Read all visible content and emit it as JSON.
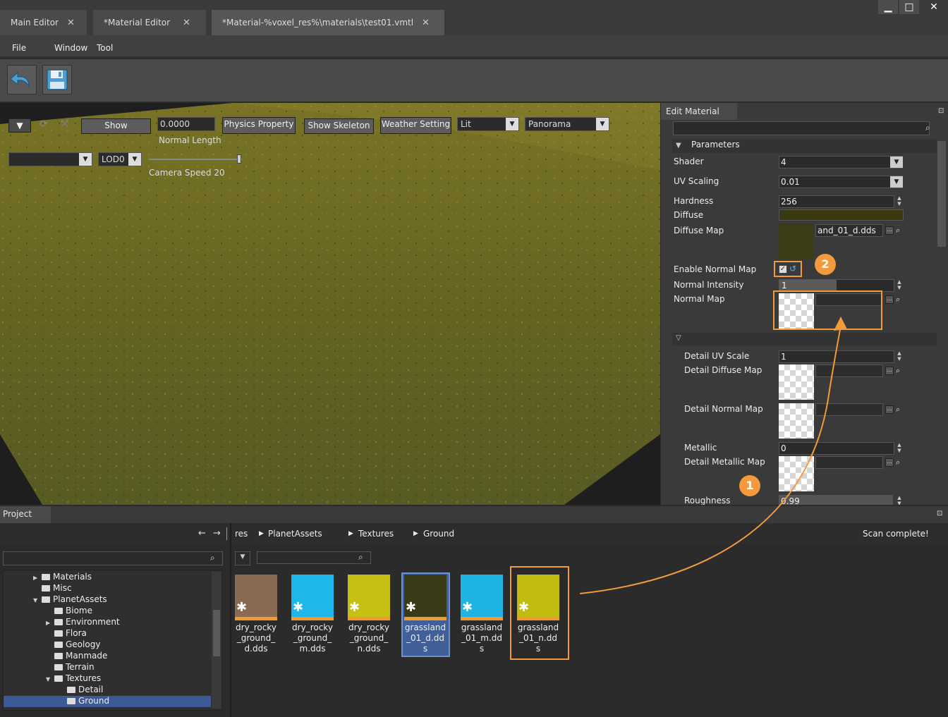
{
  "tabs": [
    {
      "label": "Main Editor"
    },
    {
      "label": "*Material Editor"
    },
    {
      "label": "*Material-%voxel_res%\\materials\\test01.vmtl"
    }
  ],
  "window_controls": {
    "minimize": "▁",
    "maximize": "□",
    "close": "✕"
  },
  "menu": {
    "file": "File",
    "window": "Window",
    "tool": "Tool"
  },
  "viewport": {
    "show_label": "Show",
    "normal_length_value": "0.0000",
    "normal_length_label": "Normal Length",
    "physics_property": "Physics Property",
    "show_skeleton": "Show Skeleton",
    "weather_setting": "Weather Setting",
    "lighting_mode": "Lit",
    "background_mode": "Panorama",
    "lod": "LOD0",
    "camera_speed": "Camera Speed 20"
  },
  "panel": {
    "title": "Edit Material",
    "section": "Parameters",
    "shader_label": "Shader",
    "shader_value": "4",
    "uv_scaling_label": "UV Scaling",
    "uv_scaling_value": "0.01",
    "hardness_label": "Hardness",
    "hardness_value": "256",
    "diffuse_label": "Diffuse",
    "diffuse_color": "#3a3a12",
    "diffuse_map_label": "Diffuse Map",
    "diffuse_map_value": "and_01_d.dds",
    "enable_normal_map_label": "Enable Normal Map",
    "normal_intensity_label": "Normal Intensity",
    "normal_intensity_value": "1",
    "normal_intensity_fill": 0.5,
    "normal_map_label": "Normal Map",
    "detail_uv_scale_label": "Detail UV Scale",
    "detail_uv_scale_value": "1",
    "detail_diffuse_map_label": "Detail Diffuse Map",
    "detail_normal_map_label": "Detail Normal Map",
    "metallic_label": "Metallic",
    "metallic_value": "0",
    "detail_metallic_map_label": "Detail Metallic Map",
    "roughness_label": "Roughness",
    "roughness_value": "0.99"
  },
  "project": {
    "tab": "Project",
    "breadcrumb": [
      "res",
      "PlanetAssets",
      "Textures",
      "Ground"
    ],
    "status": "Scan complete!",
    "tree": [
      {
        "label": "Materials"
      },
      {
        "label": "Misc"
      },
      {
        "label": "PlanetAssets"
      },
      {
        "label": "Biome"
      },
      {
        "label": "Environment"
      },
      {
        "label": "Flora"
      },
      {
        "label": "Geology"
      },
      {
        "label": "Manmade"
      },
      {
        "label": "Terrain"
      },
      {
        "label": "Textures"
      },
      {
        "label": "Detail"
      },
      {
        "label": "Ground"
      }
    ],
    "assets": [
      {
        "name": "dry_rocky_ground_d.dds",
        "color": "#8a6a50"
      },
      {
        "name": "dry_rocky_ground_m.dds",
        "color": "#1fb6ea"
      },
      {
        "name": "dry_rocky_ground_n.dds",
        "color": "#c5c012"
      },
      {
        "name": "grassland_01_d.dds",
        "color": "#3a3a16"
      },
      {
        "name": "grassland_01_m.dds",
        "color": "#1fb3e2"
      },
      {
        "name": "grassland_01_n.dds",
        "color": "#c0bd10"
      }
    ]
  },
  "annotations": {
    "badge1": "1",
    "badge2": "2"
  }
}
